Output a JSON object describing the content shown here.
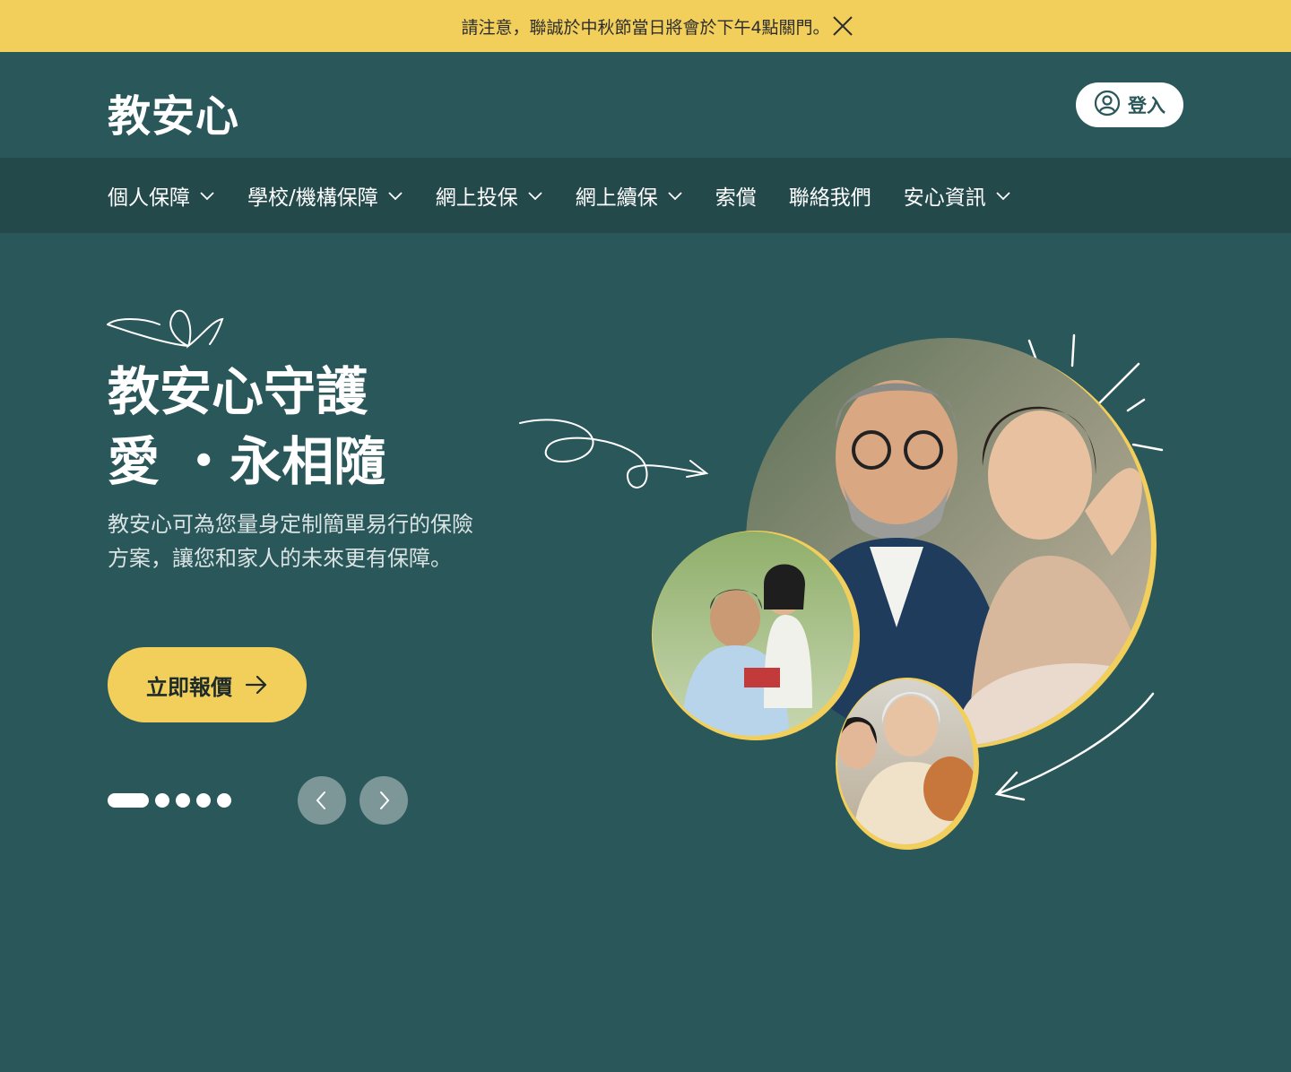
{
  "announcement": {
    "text": "請注意，聯誠於中秋節當日將會於下午4點關門。"
  },
  "header": {
    "logo": "教安心",
    "login_label": "登入"
  },
  "nav": {
    "items": [
      {
        "label": "個人保障",
        "has_dropdown": true
      },
      {
        "label": "學校/機構保障",
        "has_dropdown": true
      },
      {
        "label": "網上投保",
        "has_dropdown": true
      },
      {
        "label": "網上續保",
        "has_dropdown": true
      },
      {
        "label": "索償",
        "has_dropdown": false
      },
      {
        "label": "聯絡我們",
        "has_dropdown": false
      },
      {
        "label": "安心資訊",
        "has_dropdown": true
      }
    ]
  },
  "hero": {
    "title_line1": "教安心守護",
    "title_line2": "愛 ・永相隨",
    "description": "教安心可為您量身定制簡單易行的保險方案，讓您和家人的未來更有保障。",
    "cta_label": "立即報價"
  },
  "carousel": {
    "slide_count": 5,
    "active_index": 0
  },
  "colors": {
    "background": "#2a5759",
    "nav_background": "#23494b",
    "accent_yellow": "#f2cf5b",
    "arrow_button": "#7d9698"
  }
}
